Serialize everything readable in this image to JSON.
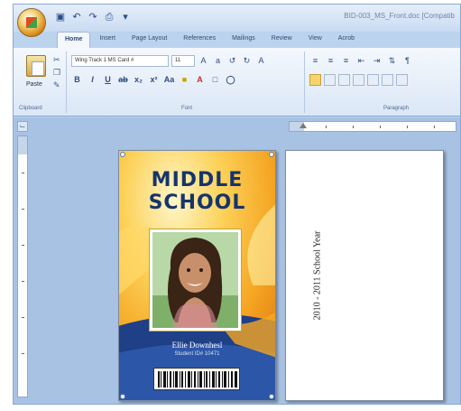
{
  "window": {
    "title": "BID-003_MS_Front.doc [Compatib"
  },
  "quick_access": {
    "icons": [
      "save-icon",
      "undo-icon",
      "redo-icon",
      "print-icon",
      "dropdown-icon"
    ]
  },
  "ribbon": {
    "tabs": [
      "Home",
      "Insert",
      "Page Layout",
      "References",
      "Mailings",
      "Review",
      "View",
      "Acrob"
    ],
    "active_tab": "Home",
    "clipboard": {
      "paste_label": "Paste",
      "group_label": "Clipboard"
    },
    "font": {
      "name": "Wing Track 1 MS Card #",
      "size": "11",
      "group_label": "Font"
    },
    "paragraph": {
      "group_label": "Paragraph"
    }
  },
  "card_front": {
    "title_line1": "MIDDLE",
    "title_line2": "SCHOOL",
    "student_name": "Ellie Downhesl",
    "student_sub": "Student ID# 10471",
    "colors": {
      "title": "#16346c",
      "accent_orange": "#f5a623",
      "band_blue": "#1f3f86"
    }
  },
  "card_back": {
    "school_year": "2010 - 2011 School Year"
  }
}
